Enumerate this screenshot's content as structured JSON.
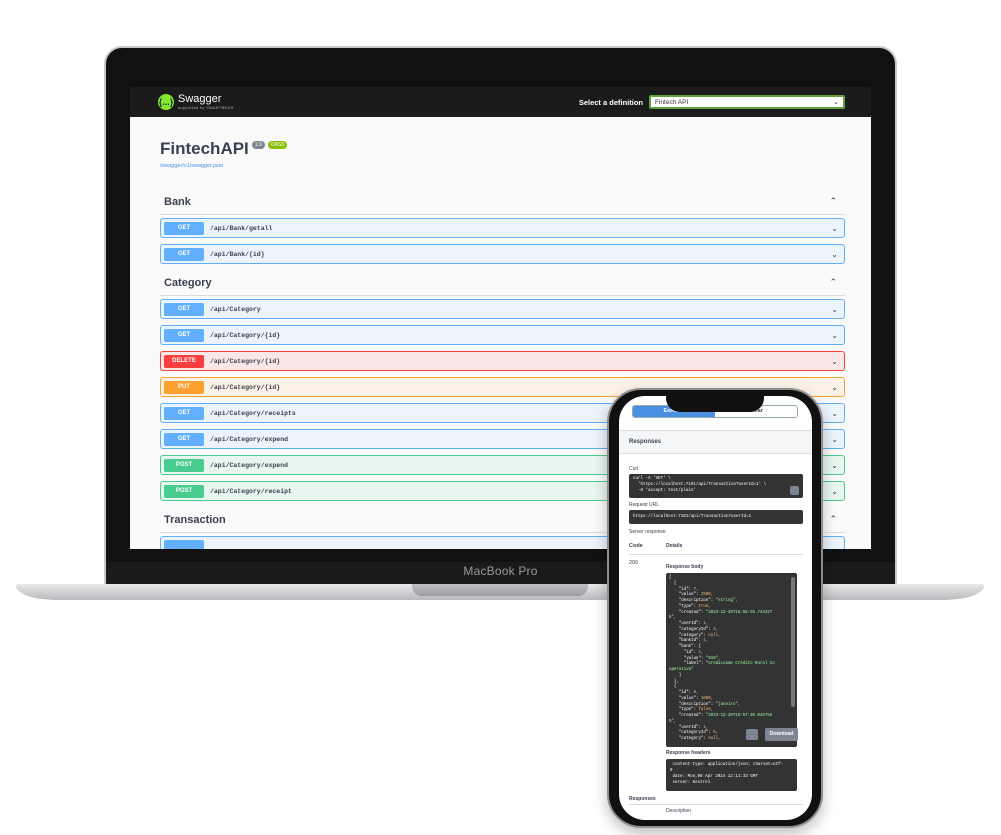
{
  "laptop": {
    "brand": "MacBook Pro"
  },
  "topbar": {
    "logo_glyph": "{...}",
    "logo_title": "Swagger",
    "logo_sub": "supported by SMARTBEAR",
    "definition_label": "Select a definition",
    "definition_value": "Fintech API"
  },
  "info": {
    "title": "FintechAPI",
    "version": "1.0",
    "oas": "OAS3",
    "link": "/swagger/v1/swagger.json"
  },
  "tags": [
    {
      "name": "Bank"
    },
    {
      "name": "Category"
    },
    {
      "name": "Transaction"
    }
  ],
  "operations": [
    {
      "method": "GET",
      "path": "/api/Bank/getall"
    },
    {
      "method": "GET",
      "path": "/api/Bank/{id}"
    },
    {
      "method": "GET",
      "path": "/api/Category"
    },
    {
      "method": "GET",
      "path": "/api/Category/{id}"
    },
    {
      "method": "DELETE",
      "path": "/api/Category/{id}"
    },
    {
      "method": "PUT",
      "path": "/api/Category/{id}"
    },
    {
      "method": "GET",
      "path": "/api/Category/receipts"
    },
    {
      "method": "GET",
      "path": "/api/Category/expend"
    },
    {
      "method": "POST",
      "path": "/api/Category/expend"
    },
    {
      "method": "POST",
      "path": "/api/Category/receipt"
    }
  ],
  "phone": {
    "execute_label": "Execute",
    "clear_label": "Clear",
    "responses_label": "Responses",
    "curl_label": "Curl",
    "curl_line1": "curl -X 'GET' \\",
    "curl_line2": "  'https://localhost:7191/api/Transaction?userId=1' \\",
    "curl_line3": "  -H 'accept: text/plain'",
    "request_url_label": "Request URL",
    "request_url": "https://localhost:7191/api/Transaction?userId=1",
    "server_response_label": "Server response",
    "code_header": "Code",
    "details_header": "Details",
    "code": "200",
    "response_body_label": "Response body",
    "download_label": "Download",
    "response_headers_label": "Response headers",
    "header_line1": " content-type: application/json; charset=utf-",
    "header_line2": "8",
    "header_line3": " date: Mon,08 Apr 2024 12:11:33 GMT",
    "header_line4": " server: Kestrel",
    "bottom_responses_label": "Responses",
    "bottom_description_label": "Description"
  },
  "response_body": [
    "[",
    "  {",
    "    \"id\": 7,",
    "    \"value\": 2500,",
    "    \"description\": \"string\",",
    "    \"type\": true,",
    "    \"created\": \"2023-12-20T15:55:55.744327",
    "8\",",
    "    \"userId\": 1,",
    "    \"categoryId\": 4,",
    "    \"category\": null,",
    "    \"bankId\": 1,",
    "    \"bank\": {",
    "      \"id\": 1,",
    "      \"value\": \"010\",",
    "      \"label\": \"Credicoamo Crédito Rural Co",
    "operativa\"",
    "    }",
    "  },",
    "  {",
    "    \"id\": 8,",
    "    \"value\": 1000,",
    "    \"description\": \"janeiro\",",
    "    \"type\": false,",
    "    \"created\": \"2023-12-20T15:57:30.045758",
    "9\",",
    "    \"userId\": 1,",
    "    \"categoryId\": 5,",
    "    \"category\": null,"
  ]
}
